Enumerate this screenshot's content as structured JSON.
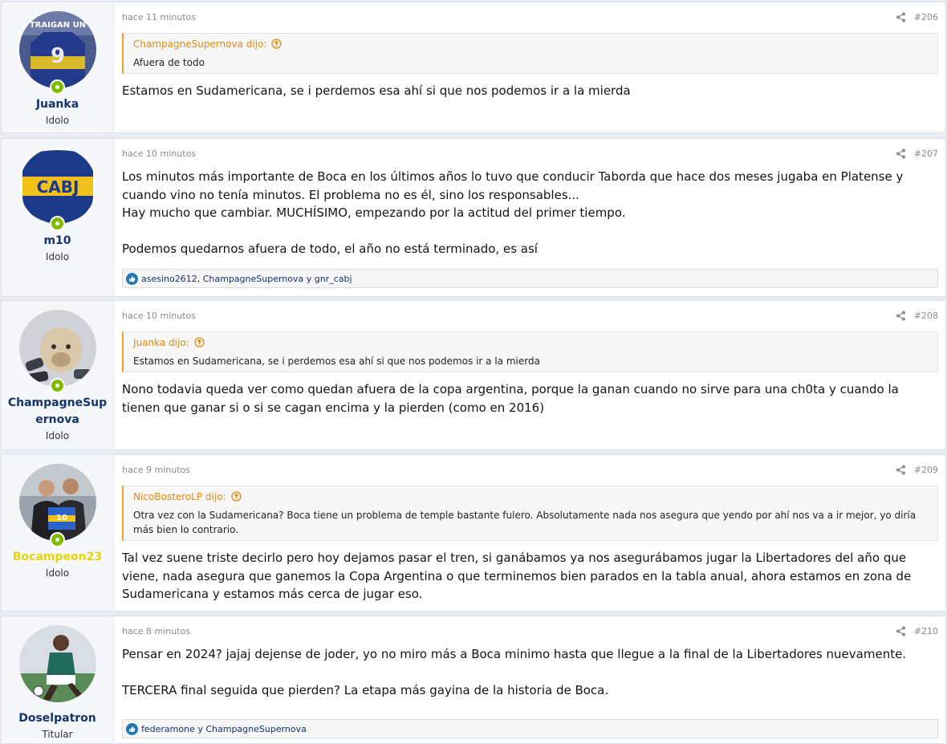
{
  "posts": [
    {
      "username": "Juanka",
      "user_title": "Idolo",
      "avatar": "boca-jersey-9-avatar",
      "time": "hace 11 minutos",
      "number": "#206",
      "quote": {
        "author": "ChampagneSupernova dijo:",
        "text": "Afuera de todo"
      },
      "message": [
        "Estamos en Sudamericana, se i perdemos esa ahí si que nos podemos ir a la mierda"
      ]
    },
    {
      "username": "m10",
      "user_title": "Idolo",
      "avatar": "cabj-crest-avatar",
      "time": "hace 10 minutos",
      "number": "#207",
      "message": [
        "Los minutos más importante de Boca en los últimos años lo tuvo que conducir Taborda que hace dos meses jugaba en Platense y cuando vino no tenía minutos. El problema no es él, sino los responsables...",
        "Hay mucho que cambiar. MUCHÍSIMO, empezando por la actitud del primer tiempo.",
        "",
        "Podemos quedarnos afuera de todo, el año no está terminado, es así"
      ],
      "reactions": "asesino2612, ChampagneSupernova y gnr_cabj"
    },
    {
      "username": "ChampagneSupernova",
      "user_title": "Idolo",
      "avatar": "lion-cub-microphones-avatar",
      "time": "hace 10 minutos",
      "number": "#208",
      "quote": {
        "author": "Juanka dijo:",
        "text": "Estamos en Sudamericana, se i perdemos esa ahí si que nos podemos ir a la mierda"
      },
      "message": [
        "Nono todavia queda ver como quedan afuera de la copa argentina, porque la ganan cuando no sirve para una ch0ta y cuando la tienen que ganar si o si se cagan encima y la pierden (como en 2016)"
      ]
    },
    {
      "username": "Bocampeon23",
      "user_title": "Idolo",
      "avatar": "two-men-jersey-photo-avatar",
      "time": "hace 9 minutos",
      "number": "#209",
      "quote": {
        "author": "NicoBosteroLP dijo:",
        "text": "Otra vez con la Sudamericana? Boca tiene un problema de temple bastante fulero. Absolutamente nada nos asegura que yendo por ahí nos va a ir mejor, yo diría más bien lo contrario."
      },
      "message": [
        "Tal vez suene triste decirlo pero hoy dejamos pasar el tren, si ganábamos ya nos asegurábamos jugar la Libertadores del año que viene, nada asegura que ganemos la Copa Argentina o que terminemos bien parados en la tabla anual, ahora estamos en zona de Sudamericana y estamos más cerca de jugar eso."
      ]
    },
    {
      "username": "Doselpatron",
      "user_title": "Titular",
      "avatar": "player-running-avatar",
      "time": "hace 8 minutos",
      "number": "#210",
      "message": [
        "Pensar en 2024? jajaj dejense de joder, yo no miro más a Boca minimo hasta que llegue a la final de la Libertadores nuevamente.",
        "",
        "TERCERA final seguida que pierden? La etapa más gayina de la historia de Boca."
      ],
      "reactions": "federamone y ChampagneSupernova"
    }
  ],
  "colors": {
    "username": "#14356b",
    "username_highlight": "#e6d400",
    "quote_accent": "#f09e1e",
    "online": "#7fb900",
    "like": "#2577b1"
  }
}
